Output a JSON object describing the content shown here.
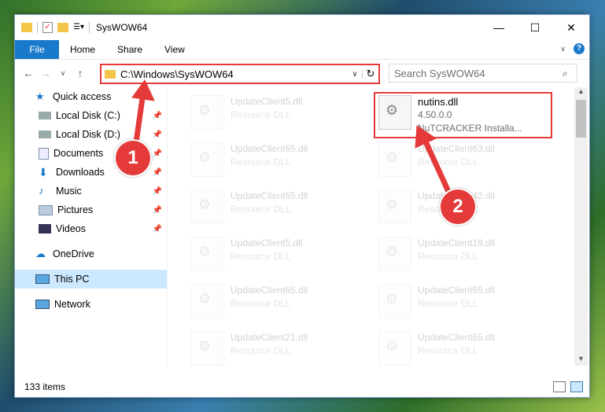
{
  "window": {
    "title": "SysWOW64",
    "controls": [
      "minimize-icon",
      "maximize-icon",
      "close-icon"
    ]
  },
  "ribbon": {
    "tabs": [
      "File",
      "Home",
      "Share",
      "View"
    ],
    "help": "?"
  },
  "navigation": {
    "address": "C:\\Windows\\SysWOW64",
    "search_placeholder": "Search SysWOW64"
  },
  "sidebar": {
    "items": [
      {
        "label": "Quick access",
        "icon": "star-icon"
      },
      {
        "label": "Local Disk (C:)",
        "icon": "drive-icon",
        "pinned": true
      },
      {
        "label": "Local Disk (D:)",
        "icon": "drive-icon",
        "pinned": true
      },
      {
        "label": "Documents",
        "icon": "documents-icon",
        "pinned": true
      },
      {
        "label": "Downloads",
        "icon": "download-icon",
        "pinned": true
      },
      {
        "label": "Music",
        "icon": "music-icon",
        "pinned": true
      },
      {
        "label": "Pictures",
        "icon": "pictures-icon",
        "pinned": true
      },
      {
        "label": "Videos",
        "icon": "videos-icon",
        "pinned": true
      },
      {
        "label": "OneDrive",
        "icon": "cloud-icon"
      },
      {
        "label": "This PC",
        "icon": "computer-icon",
        "selected": true
      },
      {
        "label": "Network",
        "icon": "network-icon"
      }
    ]
  },
  "files": [
    {
      "name": "UpdateClient5.dll",
      "type": "Resource DLL"
    },
    {
      "name": "nutins.dll",
      "version": "4.50.0.0",
      "description": "NuTCRACKER Installa..."
    },
    {
      "name": "UpdateClient65.dll",
      "type": "Resource DLL"
    },
    {
      "name": "UpdateClient63.dll",
      "type": "Resource DLL"
    },
    {
      "name": "UpdateClient65.dll",
      "type": "Resource DLL"
    },
    {
      "name": "UpdateClient42.dll",
      "type": "Resource DLL"
    },
    {
      "name": "UpdateClient5.dll",
      "type": "Resource DLL"
    },
    {
      "name": "UpdateClient19.dll",
      "type": "Resource DLL"
    },
    {
      "name": "UpdateClient65.dll",
      "type": "Resource DLL"
    },
    {
      "name": "UpdateClient65.dll",
      "type": "Resource DLL"
    },
    {
      "name": "UpdateClient21.dll",
      "type": "Resource DLL"
    },
    {
      "name": "UpdateClient65.dll",
      "type": "Resource DLL"
    }
  ],
  "status": {
    "item_count": "133 items"
  },
  "annotations": {
    "step1": "1",
    "step2": "2",
    "color": "#e53a3a"
  }
}
